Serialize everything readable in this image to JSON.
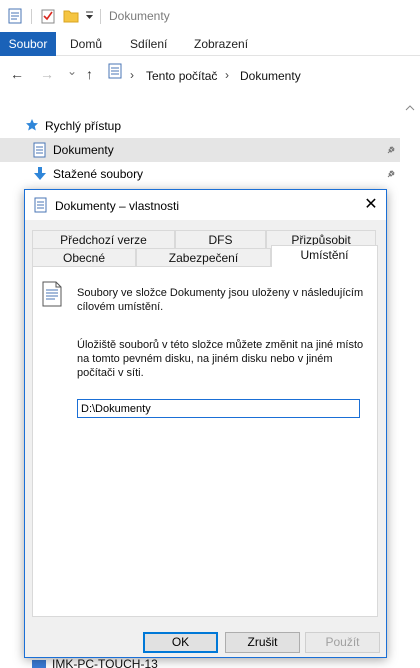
{
  "window": {
    "title": "Dokumenty"
  },
  "ribbon": {
    "tabs": [
      "Soubor",
      "Domů",
      "Sdílení",
      "Zobrazení"
    ]
  },
  "address": {
    "nav": {
      "back": "←",
      "forward": "→",
      "recent": "⌄",
      "up": "↑"
    },
    "breadcrumb": [
      "Tento počítač",
      "Dokumenty"
    ],
    "separator": "›"
  },
  "navpane": {
    "items": [
      {
        "label": "Rychlý přístup",
        "icon": "star-icon"
      },
      {
        "label": "Dokumenty",
        "icon": "documents-icon",
        "selected": true,
        "pinned": true
      },
      {
        "label": "Stažené soubory",
        "icon": "download-icon",
        "pinned": true
      }
    ],
    "bottom_item": "IMK-PC-TOUCH-13"
  },
  "dialog": {
    "title": "Dokumenty – vlastnosti",
    "close": "✕",
    "tabs_row1": [
      "Předchozí verze",
      "DFS",
      "Přizpůsobit"
    ],
    "tabs_row2": [
      "Obecné",
      "Zabezpečení",
      "Umístění"
    ],
    "active_tab": "Umístění",
    "info_text": "Soubory ve složce Dokumenty jsou uloženy v následujícím cílovém umístění.",
    "description": "Úložiště souborů v této složce můžete změnit na jiné místo na tomto pevném disku, na jiném disku nebo v jiném počítači v síti.",
    "path_value": "D:\\Dokumenty",
    "buttons": {
      "ok": "OK",
      "cancel": "Zrušit",
      "apply": "Použít"
    }
  },
  "colors": {
    "accent": "#1a62b8",
    "dialog_border": "#1a6fd6",
    "selection": "#e5e5e5"
  }
}
